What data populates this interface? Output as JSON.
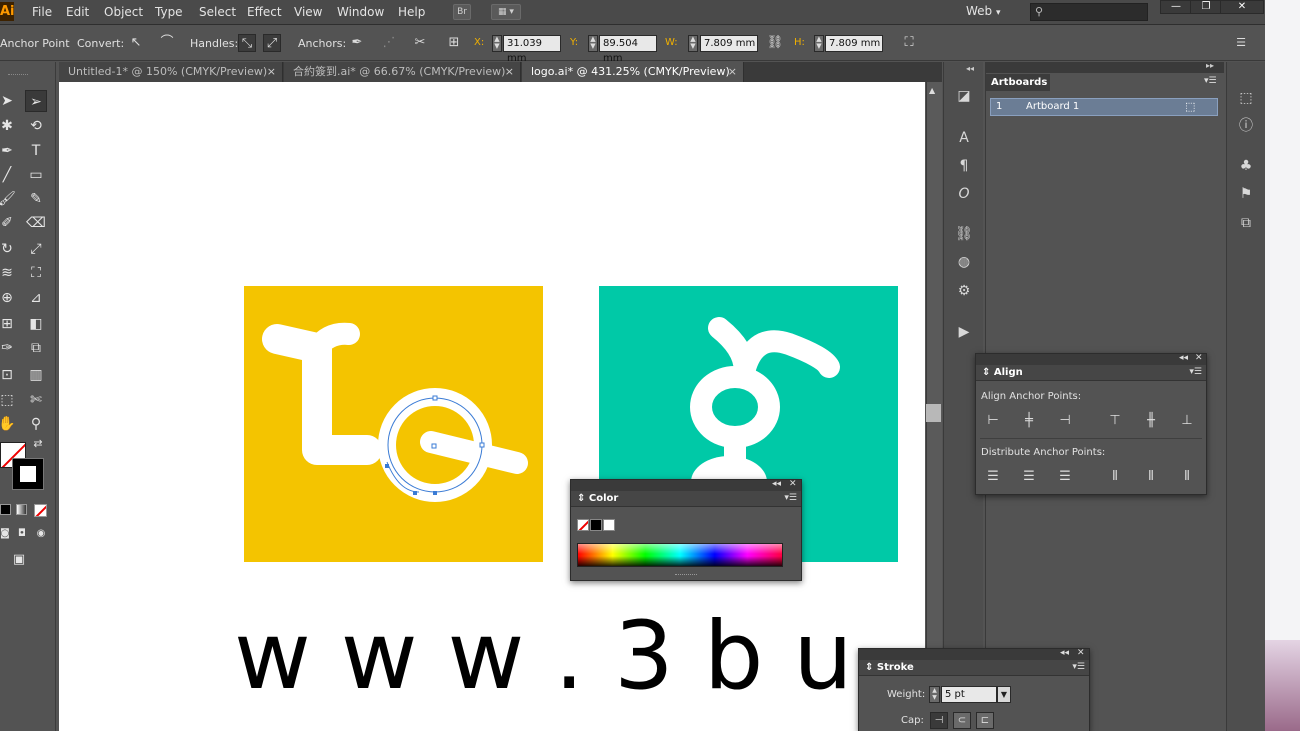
{
  "app": {
    "logo": "Ai"
  },
  "menu": [
    "File",
    "Edit",
    "Object",
    "Type",
    "Select",
    "Effect",
    "View",
    "Window",
    "Help"
  ],
  "menubar": {
    "bridge_label": "Br",
    "workspace": "Web",
    "search_value": ""
  },
  "control": {
    "tool_label": "Anchor Point",
    "convert_label": "Convert:",
    "handles_label": "Handles:",
    "anchors_label": "Anchors:",
    "x_label": "X:",
    "x_value": "31.039 mm",
    "y_label": "Y:",
    "y_value": "89.504 mm",
    "w_label": "W:",
    "w_value": "7.809 mm",
    "h_label": "H:",
    "h_value": "7.809 mm"
  },
  "tabs": [
    {
      "label": "Untitled-1* @ 150% (CMYK/Preview)",
      "active": false
    },
    {
      "label": "合約簽到.ai* @ 66.67% (CMYK/Preview)",
      "active": false
    },
    {
      "label": "logo.ai* @ 431.25% (CMYK/Preview)",
      "active": true
    }
  ],
  "canvas": {
    "bottom_text": "w w w . 3 b u",
    "card_left_color": "#f4c400",
    "card_right_color": "#00c9a7"
  },
  "artboards": {
    "title": "Artboards",
    "rows": [
      {
        "num": "1",
        "name": "Artboard 1"
      }
    ]
  },
  "align": {
    "title": "Align",
    "anchor_points_label": "Align Anchor Points:",
    "distribute_label": "Distribute Anchor Points:"
  },
  "color": {
    "title": "Color"
  },
  "stroke": {
    "title": "Stroke",
    "weight_label": "Weight:",
    "weight_value": "5 pt",
    "cap_label": "Cap:"
  }
}
